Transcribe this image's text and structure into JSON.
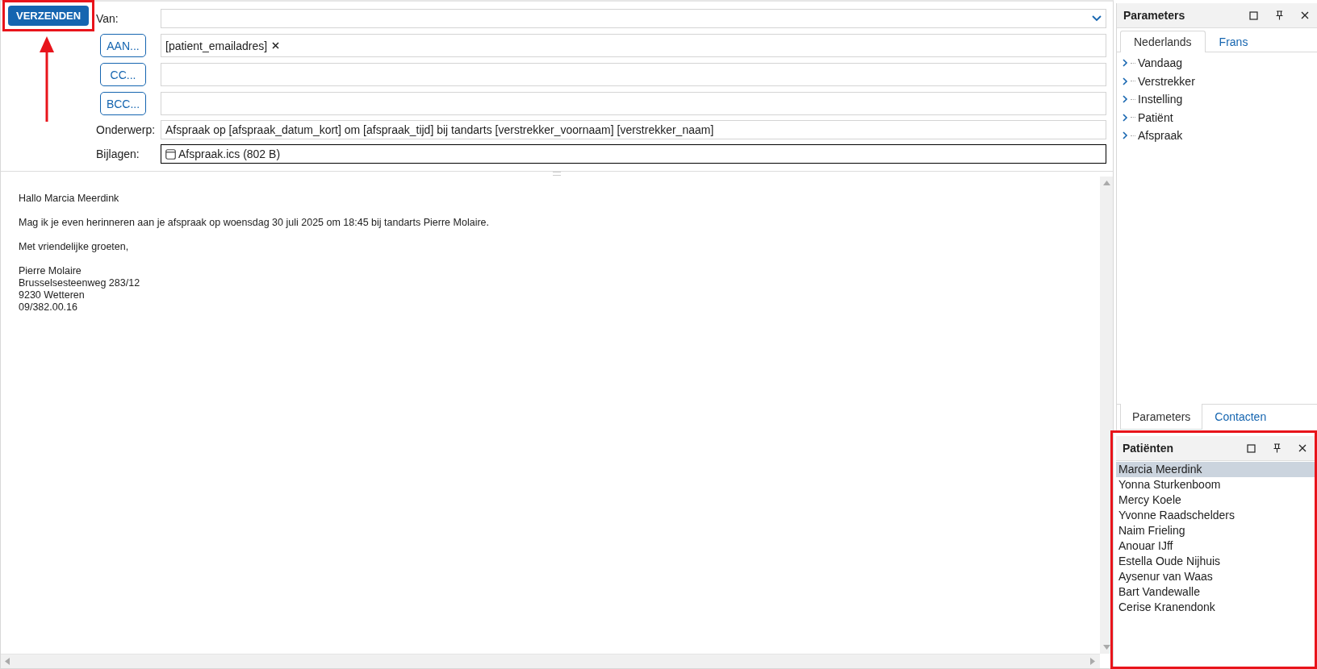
{
  "send_button": {
    "label": "VERZENDEN",
    "highlighted": true,
    "arrow_pointer": true
  },
  "from": {
    "label": "Van:"
  },
  "recipients": [
    {
      "button": "AAN...",
      "tokens": [
        "[patient_emailadres]"
      ]
    },
    {
      "button": "CC..."
    },
    {
      "button": "BCC..."
    }
  ],
  "subject": {
    "label": "Onderwerp:",
    "value": "Afspraak op [afspraak_datum_kort] om [afspraak_tijd] bij tandarts [verstrekker_voornaam] [verstrekker_naam]"
  },
  "attachments": {
    "label": "Bijlagen:",
    "files": [
      "Afspraak.ics (802 B)"
    ]
  },
  "body": [
    "Hallo Marcia Meerdink",
    "Mag ik je even herinneren aan je afspraak op woensdag 30 juli 2025 om 18:45 bij tandarts Pierre Molaire.",
    "Met vriendelijke groeten,",
    [
      "Pierre Molaire",
      "Brusselsesteenweg 283/12",
      "9230 Wetteren",
      "09/382.00.16"
    ]
  ],
  "parameters_panel": {
    "title": "Parameters",
    "tabs": [
      {
        "label": "Nederlands",
        "selected": true
      },
      {
        "label": "Frans",
        "selected": false
      }
    ],
    "tree": [
      {
        "label": "Vandaag",
        "expanded": false
      },
      {
        "label": "Verstrekker",
        "expanded": false
      },
      {
        "label": "Instelling",
        "expanded": false
      },
      {
        "label": "Patiënt",
        "expanded": false
      },
      {
        "label": "Afspraak",
        "expanded": false
      }
    ]
  },
  "bottom_tabs": [
    {
      "label": "Parameters",
      "selected": true
    },
    {
      "label": "Contacten",
      "selected": false
    }
  ],
  "patients_panel": {
    "title": "Patiënten",
    "highlighted": true,
    "items": [
      {
        "name": "Marcia Meerdink",
        "selected": true
      },
      {
        "name": "Yonna Sturkenboom",
        "selected": false
      },
      {
        "name": "Mercy Koele",
        "selected": false
      },
      {
        "name": "Yvonne Raadschelders",
        "selected": false
      },
      {
        "name": "Naim Frieling",
        "selected": false
      },
      {
        "name": "Anouar IJff",
        "selected": false
      },
      {
        "name": "Estella Oude Nijhuis",
        "selected": false
      },
      {
        "name": "Aysenur van Waas",
        "selected": false
      },
      {
        "name": "Bart Vandewalle",
        "selected": false
      },
      {
        "name": "Cerise Kranendonk",
        "selected": false
      }
    ]
  }
}
